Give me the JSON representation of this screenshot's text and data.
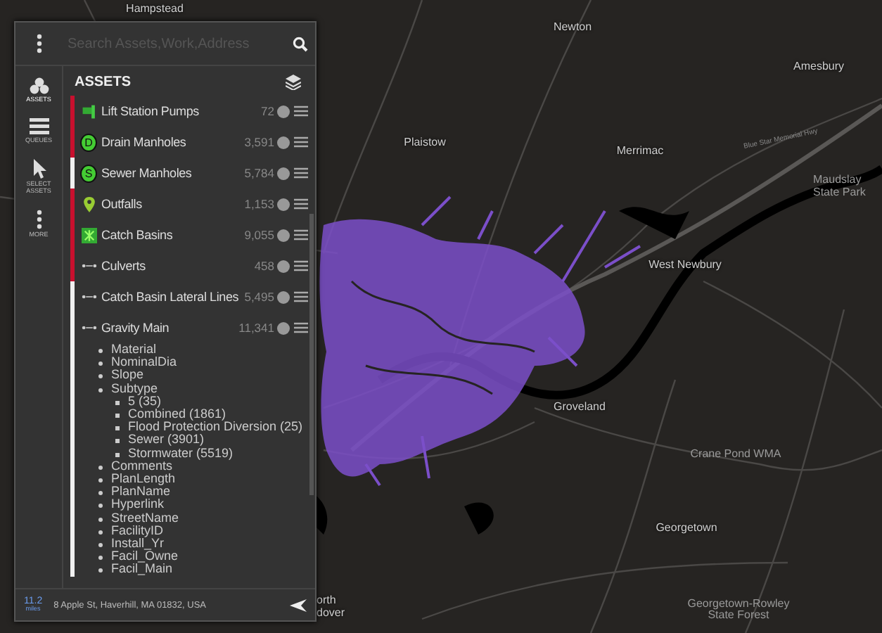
{
  "search": {
    "placeholder": "Search Assets,Work,Address"
  },
  "rail": [
    {
      "kind": "assets",
      "label": "ASSETS",
      "selected": true
    },
    {
      "kind": "queues",
      "label": "QUEUES",
      "selected": false
    },
    {
      "kind": "select",
      "label": "SELECT ASSETS",
      "selected": false
    },
    {
      "kind": "more",
      "label": "MORE",
      "selected": false
    }
  ],
  "panel_title": "ASSETS",
  "layers": [
    {
      "name": "Lift Station Pumps",
      "count": "72",
      "kind": "pump",
      "color": "#c8102e"
    },
    {
      "name": "Drain Manholes",
      "count": "3,591",
      "kind": "letter",
      "symbol": "D",
      "color": "#c8102e"
    },
    {
      "name": "Sewer Manholes",
      "count": "5,784",
      "kind": "letter",
      "symbol": "S",
      "color": "#f0f0f0"
    },
    {
      "name": "Outfalls",
      "count": "1,153",
      "kind": "pin",
      "color": "#c8102e"
    },
    {
      "name": "Catch Basins",
      "count": "9,055",
      "kind": "grate",
      "color": "#c8102e"
    },
    {
      "name": "Culverts",
      "count": "458",
      "kind": "line",
      "color": "#c8102e"
    },
    {
      "name": "Catch Basin Lateral Lines",
      "count": "5,495",
      "kind": "line",
      "color": "#f0f0f0"
    },
    {
      "name": "Gravity Main",
      "count": "11,341",
      "kind": "line",
      "color": "#f0f0f0",
      "fields": [
        {
          "name": "Material"
        },
        {
          "name": "NominalDia"
        },
        {
          "name": "Slope"
        },
        {
          "name": "Subtype",
          "children": [
            {
              "name": "5 (35)"
            },
            {
              "name": "Combined (1861)"
            },
            {
              "name": "Flood Protection Diversion (25)"
            },
            {
              "name": "Sewer (3901)"
            },
            {
              "name": "Stormwater (5519)"
            }
          ]
        },
        {
          "name": "Comments"
        },
        {
          "name": "PlanLength"
        },
        {
          "name": "PlanName"
        },
        {
          "name": "Hyperlink"
        },
        {
          "name": "StreetName"
        },
        {
          "name": "FacilityID"
        },
        {
          "name": "Install_Yr"
        },
        {
          "name": "Facil_Owne"
        },
        {
          "name": "Facil_Main"
        }
      ]
    }
  ],
  "footer": {
    "distance": "11.2",
    "unit": "miles",
    "address": "8 Apple St, Haverhill, MA 01832, USA"
  },
  "map_labels": [
    {
      "text": "Hampstead",
      "kind": "town"
    },
    {
      "text": "Newton",
      "kind": "town"
    },
    {
      "text": "Amesbury",
      "kind": "town"
    },
    {
      "text": "Plaistow",
      "kind": "town"
    },
    {
      "text": "Merrimac",
      "kind": "town"
    },
    {
      "text": "Blue Star Memorial Hwy",
      "kind": "road"
    },
    {
      "text": "Maudslay State Park",
      "kind": "park"
    },
    {
      "text": "West Newbury",
      "kind": "town"
    },
    {
      "text": "Groveland",
      "kind": "town"
    },
    {
      "text": "Crane Pond WMA",
      "kind": "park"
    },
    {
      "text": "Georgetown",
      "kind": "town"
    },
    {
      "text": "orth dover",
      "kind": "town"
    },
    {
      "text": "Georgetown-Rowley State Forest",
      "kind": "park"
    }
  ]
}
